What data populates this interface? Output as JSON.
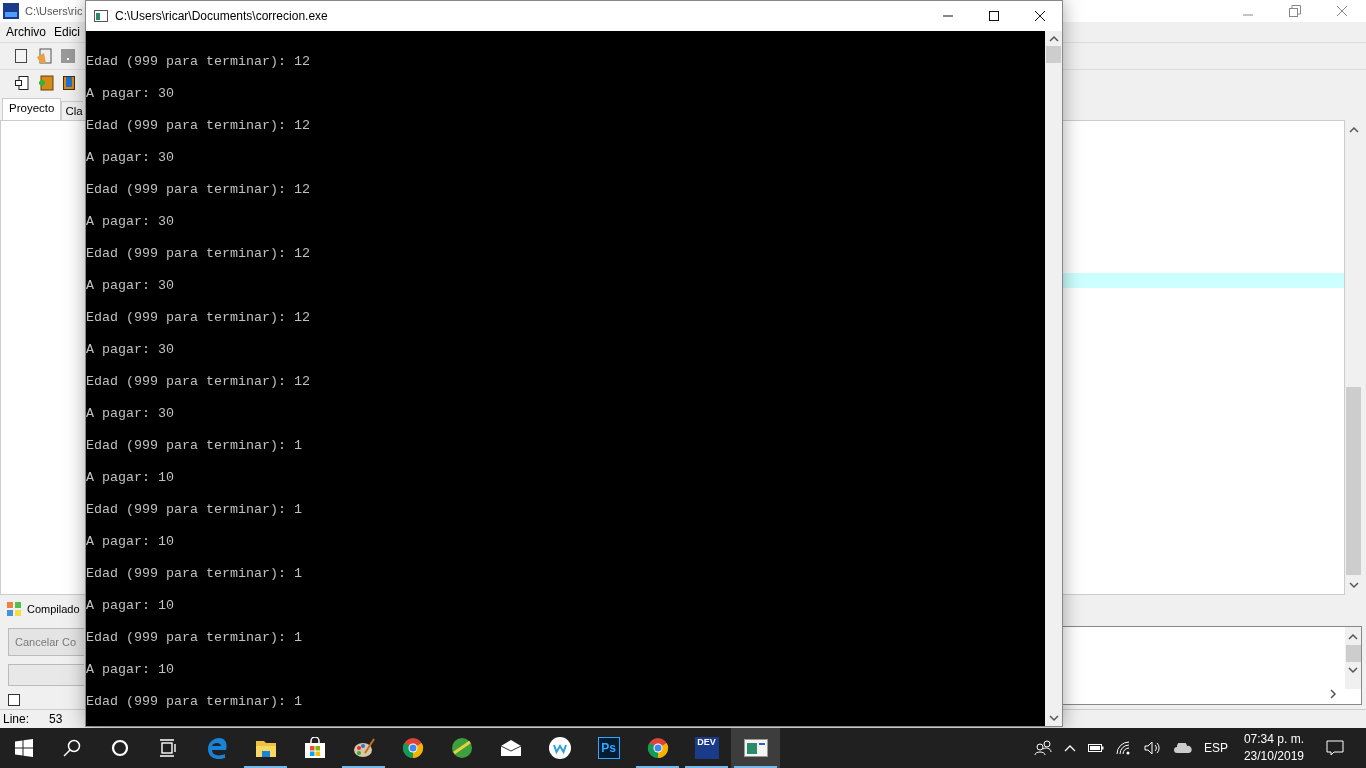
{
  "ide": {
    "title": "C:\\Users\\ric",
    "menu": [
      "Archivo",
      "Edici"
    ],
    "tabs": [
      {
        "label": "Proyecto",
        "selected": true
      },
      {
        "label": "Cla",
        "selected": false
      }
    ],
    "bottom_tab": "Compilado",
    "cancel_button": {
      "label": "Cancelar Co",
      "disabled": true
    },
    "checkbox": {
      "checked": false
    },
    "status": {
      "label": "Line:",
      "value": "53"
    }
  },
  "console": {
    "title": "C:\\Users\\ricar\\Documents\\correcion.exe",
    "lines": [
      "Edad (999 para terminar): 12",
      "A pagar: 30",
      "Edad (999 para terminar): 12",
      "A pagar: 30",
      "Edad (999 para terminar): 12",
      "A pagar: 30",
      "Edad (999 para terminar): 12",
      "A pagar: 30",
      "Edad (999 para terminar): 12",
      "A pagar: 30",
      "Edad (999 para terminar): 12",
      "A pagar: 30",
      "Edad (999 para terminar): 1",
      "A pagar: 10",
      "Edad (999 para terminar): 1",
      "A pagar: 10",
      "Edad (999 para terminar): 1",
      "A pagar: 10",
      "Edad (999 para terminar): 1",
      "A pagar: 10",
      "Edad (999 para terminar): 1"
    ]
  },
  "taskbar": {
    "apps": [
      {
        "kind": "edge",
        "running": false,
        "selected": false
      },
      {
        "kind": "folder",
        "running": true,
        "selected": false
      },
      {
        "kind": "store",
        "running": false,
        "selected": false
      },
      {
        "kind": "paint",
        "running": true,
        "selected": false
      },
      {
        "kind": "chrome",
        "running": false,
        "selected": false
      },
      {
        "kind": "green",
        "running": false,
        "selected": false
      },
      {
        "kind": "mail",
        "running": false,
        "selected": false
      },
      {
        "kind": "w",
        "running": false,
        "selected": false
      },
      {
        "kind": "ps",
        "running": false,
        "selected": false
      },
      {
        "kind": "chrome",
        "running": true,
        "selected": false
      },
      {
        "kind": "dev",
        "running": true,
        "selected": false
      },
      {
        "kind": "console",
        "running": true,
        "selected": true
      }
    ],
    "ps_label": "Ps",
    "dev_label": "DEV",
    "language": "ESP",
    "time": "07:34 p. m.",
    "date": "23/10/2019"
  }
}
